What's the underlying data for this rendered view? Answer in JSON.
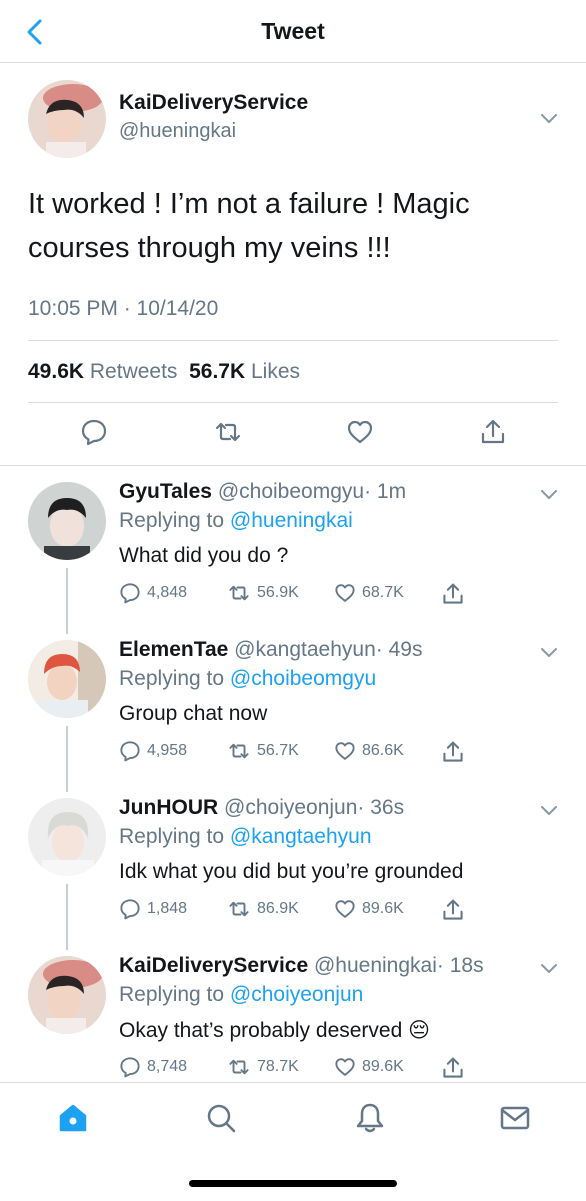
{
  "header": {
    "title": "Tweet"
  },
  "main_tweet": {
    "display_name": "KaiDeliveryService",
    "handle": "@hueningkai",
    "text": "It worked ! I’m not a failure ! Magic courses through my veins !!!",
    "timestamp": "10:05 PM · 10/14/20",
    "retweets_count": "49.6K",
    "retweets_label": "Retweets",
    "likes_count": "56.7K",
    "likes_label": "Likes"
  },
  "replies": [
    {
      "display_name": "GyuTales",
      "handle": "@choibeomgyu",
      "time": "· 1m",
      "replying_prefix": "Replying to",
      "replying_to": "@hueningkai",
      "text": "What did you do ?",
      "comments": "4,848",
      "retweets": "56.9K",
      "likes": "68.7K"
    },
    {
      "display_name": "ElemenTae",
      "handle": "@kangtaehyun",
      "time": "· 49s",
      "replying_prefix": "Replying to",
      "replying_to": "@choibeomgyu",
      "text": "Group chat now",
      "comments": "4,958",
      "retweets": "56.7K",
      "likes": "86.6K"
    },
    {
      "display_name": "JunHOUR",
      "handle": "@choiyeonjun",
      "time": "· 36s",
      "replying_prefix": "Replying to",
      "replying_to": "@kangtaehyun",
      "text": "Idk what you did but you’re grounded",
      "comments": "1,848",
      "retweets": "86.9K",
      "likes": "89.6K"
    },
    {
      "display_name": "KaiDeliveryService",
      "handle": "@hueningkai",
      "time": "· 18s",
      "replying_prefix": "Replying to",
      "replying_to": "@choiyeonjun",
      "text": "Okay that’s probably deserved",
      "emoji": "😔",
      "comments": "8,748",
      "retweets": "78.7K",
      "likes": "89.6K"
    }
  ],
  "tabbar": {
    "icons": [
      "home-icon",
      "search-icon",
      "bell-icon",
      "mail-icon"
    ]
  },
  "colors": {
    "accent": "#1da1f2",
    "muted": "#657786",
    "text": "#14171a",
    "divider": "#d8dde2"
  }
}
